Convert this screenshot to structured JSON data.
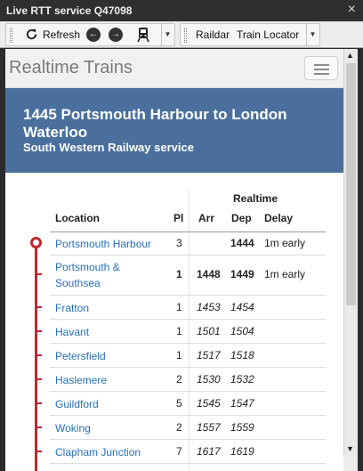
{
  "window": {
    "title": "Live RTT service Q47098",
    "close_glyph": "×"
  },
  "toolbar": {
    "refresh_label": "Refresh",
    "raildar_label": "Raildar",
    "locator_label": "Train Locator"
  },
  "navbar": {
    "brand": "Realtime Trains"
  },
  "service": {
    "title": "1445 Portsmouth Harbour to London Waterloo",
    "operator": "South Western Railway service"
  },
  "table": {
    "group_header": "Realtime",
    "headers": {
      "location": "Location",
      "platform": "Pl",
      "arr": "Arr",
      "dep": "Dep",
      "delay": "Delay"
    },
    "rows": [
      {
        "location": "Portsmouth Harbour",
        "platform": "3",
        "arr": "",
        "dep": "1444",
        "delay": "1m early"
      },
      {
        "location": "Portsmouth & Southsea",
        "platform": "1",
        "arr": "1448",
        "dep": "1449",
        "delay": "1m early"
      },
      {
        "location": "Fratton",
        "platform": "1",
        "arr": "1453",
        "dep": "1454",
        "delay": ""
      },
      {
        "location": "Havant",
        "platform": "1",
        "arr": "1501",
        "dep": "1504",
        "delay": ""
      },
      {
        "location": "Petersfield",
        "platform": "1",
        "arr": "1517",
        "dep": "1518",
        "delay": ""
      },
      {
        "location": "Haslemere",
        "platform": "2",
        "arr": "1530",
        "dep": "1532",
        "delay": ""
      },
      {
        "location": "Guildford",
        "platform": "5",
        "arr": "1545",
        "dep": "1547",
        "delay": ""
      },
      {
        "location": "Woking",
        "platform": "2",
        "arr": "1557",
        "dep": "1559",
        "delay": ""
      },
      {
        "location": "Clapham Junction",
        "platform": "7",
        "arr": "1617",
        "dep": "1619",
        "delay": ""
      }
    ]
  },
  "colors": {
    "header_bg": "#4a6f9c",
    "link": "#2a6ebb",
    "track": "#c0272d"
  }
}
